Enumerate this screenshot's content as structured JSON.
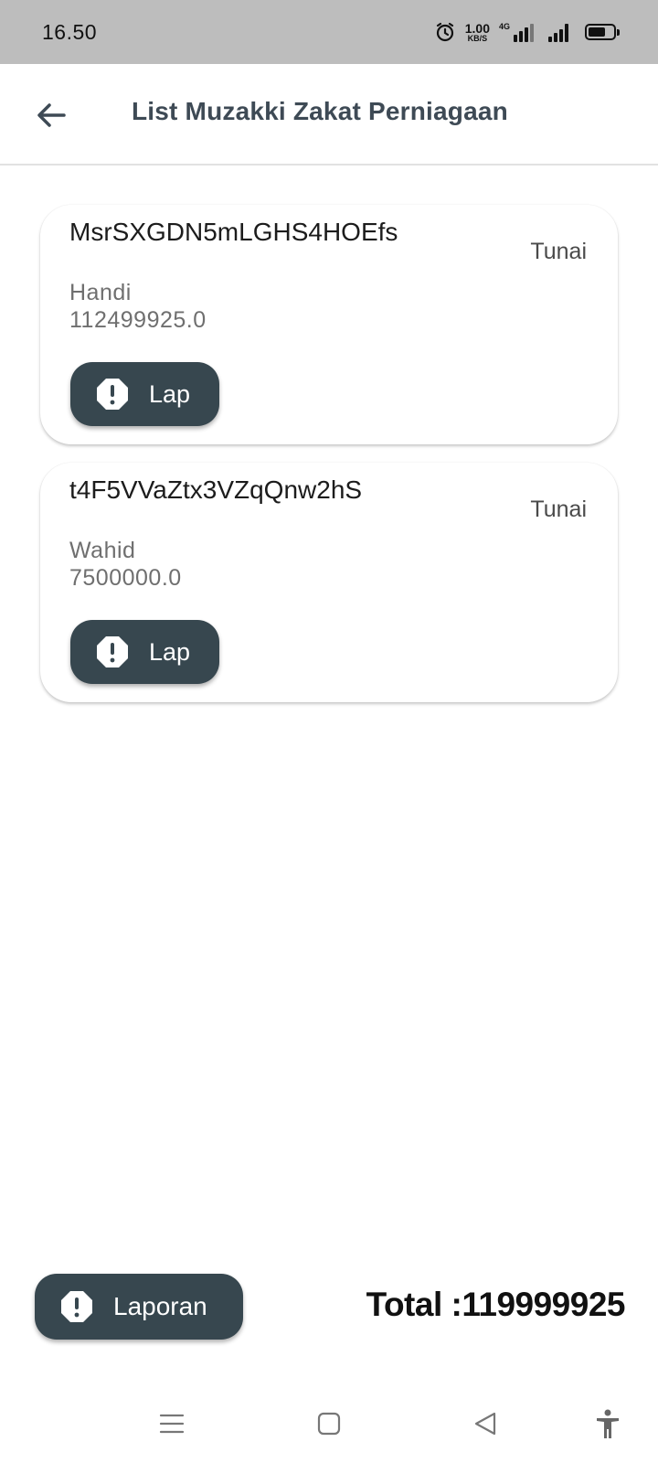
{
  "status_bar": {
    "time": "16.50",
    "net_speed_value": "1.00",
    "net_speed_unit": "KB/S",
    "network_label": "4G"
  },
  "app_bar": {
    "title": "List Muzakki Zakat Perniagaan",
    "back_icon": "arrow-left-icon"
  },
  "muzakki": [
    {
      "id": "MsrSXGDN5mLGHS4HOEfs",
      "method": "Tunai",
      "name": "Handi",
      "amount": "112499925.0",
      "button_label": "Lap"
    },
    {
      "id": "t4F5VVaZtx3VZqQnw2hS",
      "method": "Tunai",
      "name": "Wahid",
      "amount": "7500000.0",
      "button_label": "Lap"
    }
  ],
  "footer": {
    "laporan_label": "Laporan",
    "total_text": "Total :119999925"
  },
  "nav": {
    "items": [
      "menu-icon",
      "home-square-icon",
      "back-triangle-icon",
      "accessibility-icon"
    ]
  },
  "colors": {
    "status_bar_bg": "#bdbdbd",
    "button_bg": "#37474f",
    "title_color": "#3e4a55"
  }
}
